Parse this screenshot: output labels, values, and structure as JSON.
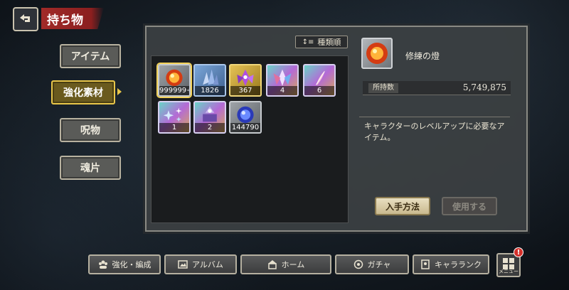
{
  "header": {
    "title": "持ち物"
  },
  "tabs": [
    {
      "label": "アイテム"
    },
    {
      "label": "強化素材"
    },
    {
      "label": "呪物"
    },
    {
      "label": "魂片"
    }
  ],
  "sort": {
    "label": "種類順"
  },
  "items": [
    {
      "name": "orb-red-icon",
      "count": "999999+",
      "rarity": "gray"
    },
    {
      "name": "crystal-blue-icon",
      "count": "1826",
      "rarity": "blue"
    },
    {
      "name": "crystal-purple-icon",
      "count": "367",
      "rarity": "gold"
    },
    {
      "name": "crystal-rainbow-icon",
      "count": "4",
      "rarity": "rainbow"
    },
    {
      "name": "feather-icon",
      "count": "6",
      "rarity": "rainbow"
    },
    {
      "name": "sparkle-blue-icon",
      "count": "1",
      "rarity": "rainbow"
    },
    {
      "name": "box-purple-icon",
      "count": "2",
      "rarity": "rainbow"
    },
    {
      "name": "orb-blue-icon",
      "count": "144790",
      "rarity": "gray"
    }
  ],
  "detail": {
    "name": "修練の燈",
    "owned_label": "所持数",
    "owned_value": "5,749,875",
    "description": "キャラクターのレベルアップに必要なアイテム。",
    "obtain_label": "入手方法",
    "use_label": "使用する"
  },
  "nav": {
    "enhance": "強化・編成",
    "album": "アルバム",
    "home": "ホーム",
    "gacha": "ガチャ",
    "ranking": "キャラランク",
    "menu": "メニュー",
    "badge": "!"
  },
  "colors": {
    "accent_gold": "#e8c64a",
    "title_red": "#a12a28"
  }
}
